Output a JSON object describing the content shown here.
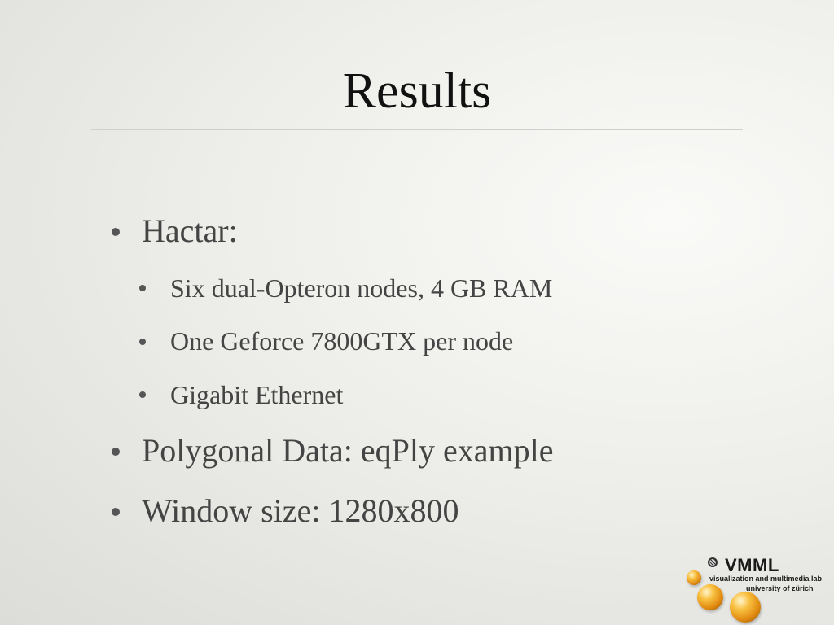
{
  "slide": {
    "title": "Results",
    "bullets": [
      {
        "text": "Hactar:",
        "sub": [
          "Six dual-Opteron nodes, 4 GB RAM",
          "One Geforce 7800GTX per node",
          "Gigabit Ethernet"
        ]
      },
      {
        "text": "Polygonal Data: eqPly example"
      },
      {
        "text": "Window size: 1280x800"
      }
    ]
  },
  "logo": {
    "name": "VMML",
    "line1": "visualization and multimedia lab",
    "line2": "university of zürich"
  }
}
